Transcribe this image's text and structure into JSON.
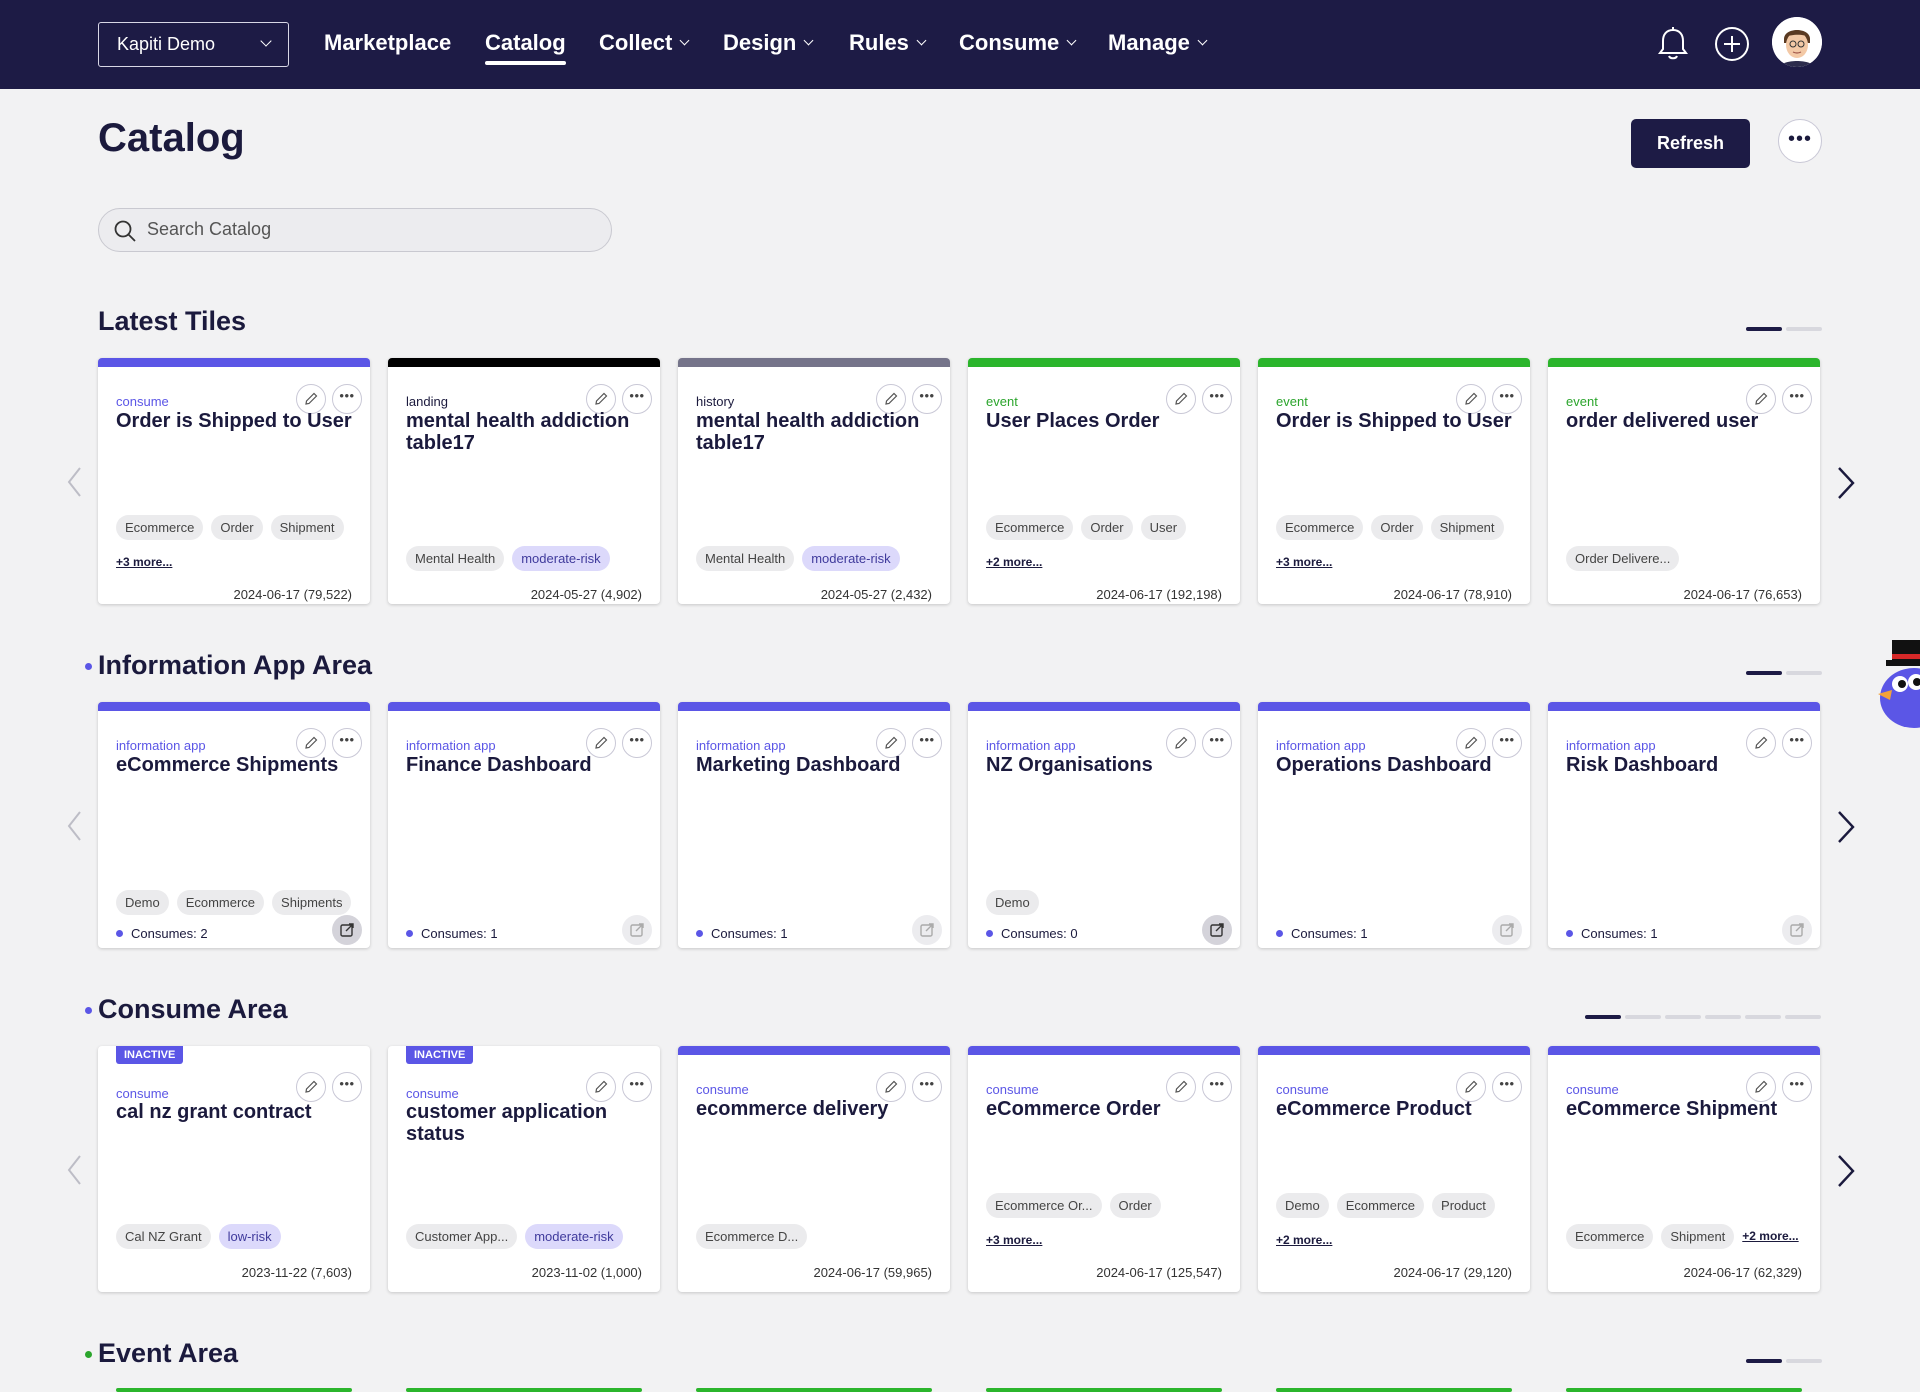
{
  "nav": {
    "tenant": "Kapiti Demo",
    "items": [
      {
        "label": "Marketplace",
        "dropdown": false,
        "active": false
      },
      {
        "label": "Catalog",
        "dropdown": false,
        "active": true
      },
      {
        "label": "Collect",
        "dropdown": true,
        "active": false
      },
      {
        "label": "Design",
        "dropdown": true,
        "active": false
      },
      {
        "label": "Rules",
        "dropdown": true,
        "active": false
      },
      {
        "label": "Consume",
        "dropdown": true,
        "active": false
      },
      {
        "label": "Manage",
        "dropdown": true,
        "active": false
      }
    ],
    "icons": [
      "bell-icon",
      "plus-circle-icon",
      "avatar"
    ]
  },
  "header": {
    "title": "Catalog",
    "refresh_label": "Refresh",
    "more_label": "•••"
  },
  "search": {
    "placeholder": "Search Catalog"
  },
  "sections": [
    {
      "title": "Latest Tiles",
      "pager_total": 2,
      "pager_active": 0,
      "cards": [
        {
          "type": "consume",
          "title": "Order is Shipped to User",
          "tags": [
            "Ecommerce",
            "Order",
            "Shipment"
          ],
          "more": "+3 more...",
          "meta": "2024-06-17 (79,522)"
        },
        {
          "type": "landing",
          "title": "mental health addiction table17",
          "tags": [
            "Mental Health",
            "moderate-risk"
          ],
          "meta": "2024-05-27 (4,902)"
        },
        {
          "type": "history",
          "title": "mental health addiction table17",
          "tags": [
            "Mental Health",
            "moderate-risk"
          ],
          "meta": "2024-05-27 (2,432)"
        },
        {
          "type": "event",
          "title": "User Places Order",
          "tags": [
            "Ecommerce",
            "Order",
            "User"
          ],
          "more": "+2 more...",
          "meta": "2024-06-17 (192,198)"
        },
        {
          "type": "event",
          "title": "Order is Shipped to User",
          "tags": [
            "Ecommerce",
            "Order",
            "Shipment"
          ],
          "more": "+3 more...",
          "meta": "2024-06-17 (78,910)"
        },
        {
          "type": "event",
          "title": "order delivered user",
          "tags": [
            "Order Delivere..."
          ],
          "meta": "2024-06-17 (76,653)"
        }
      ]
    },
    {
      "title": "Information App Area",
      "pager_total": 2,
      "pager_active": 0,
      "cards": [
        {
          "type": "information app",
          "title": "eCommerce Shipments",
          "tags": [
            "Demo",
            "Ecommerce",
            "Shipments"
          ],
          "consumes": "Consumes: 2"
        },
        {
          "type": "information app",
          "title": "Finance Dashboard",
          "tags": [],
          "consumes": "Consumes: 1"
        },
        {
          "type": "information app",
          "title": "Marketing Dashboard",
          "tags": [],
          "consumes": "Consumes: 1"
        },
        {
          "type": "information app",
          "title": "NZ Organisations",
          "tags": [
            "Demo"
          ],
          "consumes": "Consumes: 0"
        },
        {
          "type": "information app",
          "title": "Operations Dashboard",
          "tags": [],
          "consumes": "Consumes: 1"
        },
        {
          "type": "information app",
          "title": "Risk Dashboard",
          "tags": [],
          "consumes": "Consumes: 1"
        }
      ]
    },
    {
      "title": "Consume Area",
      "pager_total": 6,
      "pager_active": 0,
      "cards": [
        {
          "type": "consume",
          "inactive": "INACTIVE",
          "title": "cal nz grant contract",
          "tags": [
            "Cal NZ Grant",
            "low-risk"
          ],
          "meta": "2023-11-22 (7,603)"
        },
        {
          "type": "consume",
          "inactive": "INACTIVE",
          "title": "customer application status",
          "tags": [
            "Customer App...",
            "moderate-risk"
          ],
          "meta": "2023-11-02 (1,000)"
        },
        {
          "type": "consume",
          "title": "ecommerce delivery",
          "tags": [
            "Ecommerce D..."
          ],
          "meta": "2024-06-17 (59,965)"
        },
        {
          "type": "consume",
          "title": "eCommerce Order",
          "tags": [
            "Ecommerce Or...",
            "Order"
          ],
          "more": "+3 more...",
          "meta": "2024-06-17 (125,547)"
        },
        {
          "type": "consume",
          "title": "eCommerce Product",
          "tags": [
            "Demo",
            "Ecommerce",
            "Product"
          ],
          "more": "+2 more...",
          "meta": "2024-06-17 (29,120)"
        },
        {
          "type": "consume",
          "title": "eCommerce Shipment",
          "tags": [
            "Ecommerce",
            "Shipment"
          ],
          "more_inline": "+2 more...",
          "meta": "2024-06-17 (62,329)"
        }
      ]
    },
    {
      "title": "Event Area",
      "pager_total": 2,
      "pager_active": 0,
      "cards": []
    }
  ],
  "colors": {
    "nav_bg": "#1d1b45",
    "accent_purple": "#5b56e6",
    "event_green": "#2bb52c",
    "landing_black": "#000000",
    "history_gray": "#75748a"
  }
}
